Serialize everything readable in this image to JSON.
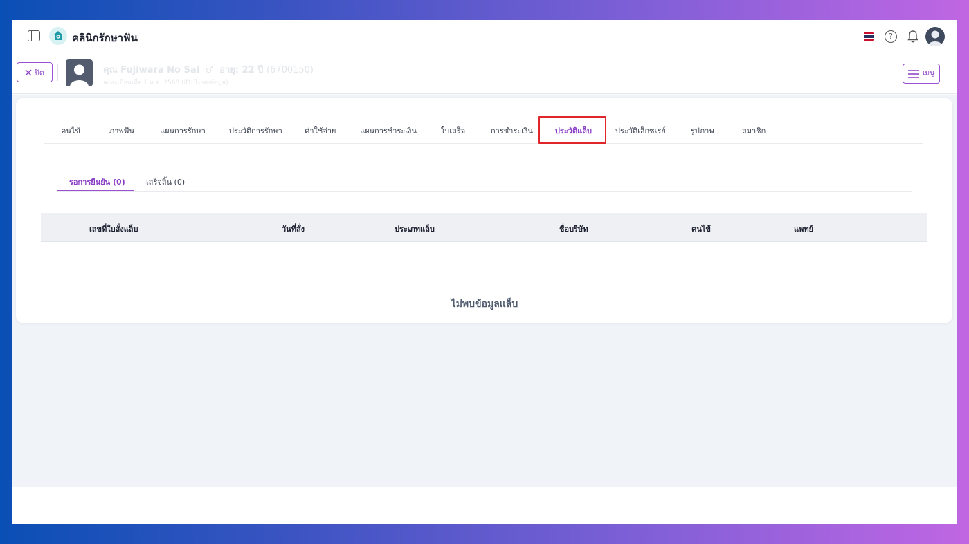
{
  "app": {
    "title": "คลินิกรักษาฟัน"
  },
  "header": {
    "flag": "thai-flag-icon"
  },
  "patient": {
    "name": "คุณ Fujiwara No Sai",
    "age": "อายุ: 22 ปี",
    "hn": "(6700150)",
    "sub": "ลงทะเบียนเมื่อ 1 ม.ค. 2568 (ID: ไม่พบข้อมูล)"
  },
  "buttons": {
    "close_label": "ปิด",
    "menu_label": "เมนู"
  },
  "tabs": [
    "คนไข้",
    "ภาพฟัน",
    "แผนการรักษา",
    "ประวัติการรักษา",
    "ค่าใช้จ่าย",
    "แผนการชำระเงิน",
    "ใบเสร็จ",
    "การชำระเงิน",
    "ประวัติแล็บ",
    "ประวัติเอ็กซเรย์",
    "รูปภาพ",
    "สมาชิก"
  ],
  "active_tab": "ประวัติแล็บ",
  "subtabs": [
    "รอการยืนยัน (0)",
    "เสร็จสิ้น (0)"
  ],
  "table": {
    "columns": [
      "เลขที่ใบสั่งแล็บ",
      "วันที่สั่ง",
      "ประเภทแล็บ",
      "ชื่อบริษัท",
      "คนไข้",
      "แพทย์"
    ]
  },
  "empty_message": "ไม่พบข้อมูลแล็บ",
  "colors": {
    "accent": "#9b4fd1",
    "highlight": "#e0262b",
    "background": "#f0f3f8"
  }
}
